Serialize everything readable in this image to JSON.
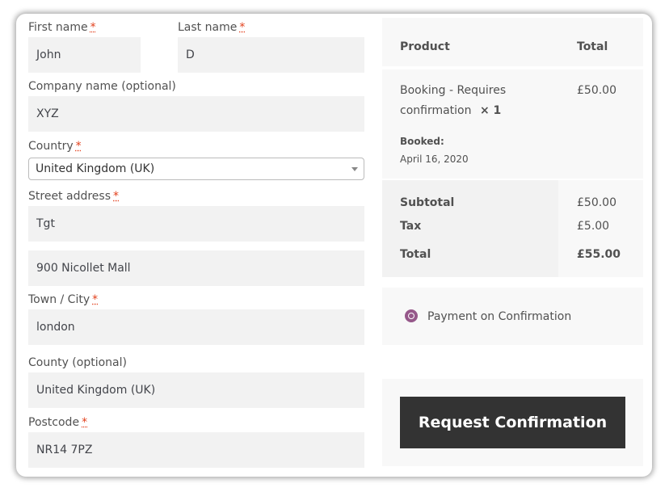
{
  "billing": {
    "first_name": {
      "label": "First name",
      "required_mark": "*",
      "value": "John"
    },
    "last_name": {
      "label": "Last name",
      "required_mark": "*",
      "value": "D"
    },
    "company": {
      "label": "Company name (optional)",
      "value": "XYZ"
    },
    "country": {
      "label": "Country",
      "required_mark": "*",
      "value": "United Kingdom (UK)"
    },
    "street": {
      "label": "Street address",
      "required_mark": "*",
      "line1": "Tgt",
      "line2": "900 Nicollet Mall"
    },
    "town": {
      "label": "Town / City",
      "required_mark": "*",
      "value": "london"
    },
    "county": {
      "label": "County (optional)",
      "value": "United Kingdom (UK)"
    },
    "postcode": {
      "label": "Postcode",
      "required_mark": "*",
      "value": "NR14 7PZ"
    }
  },
  "order": {
    "col_product": "Product",
    "col_total": "Total",
    "item": {
      "name_line1": "Booking - Requires",
      "name_line2": "confirmation",
      "qty": "× 1",
      "price": "£50.00",
      "meta_label": "Booked:",
      "meta_value": "April 16, 2020"
    },
    "subtotal_label": "Subtotal",
    "subtotal_value": "£50.00",
    "tax_label": "Tax",
    "tax_value": "£5.00",
    "total_label": "Total",
    "total_value": "£55.00"
  },
  "payment": {
    "method_label": "Payment on Confirmation",
    "submit_label": "Request Confirmation"
  },
  "colors": {
    "accent": "#96588a",
    "required": "#e2401c",
    "button_bg": "#333333",
    "field_bg": "#f2f2f2"
  }
}
